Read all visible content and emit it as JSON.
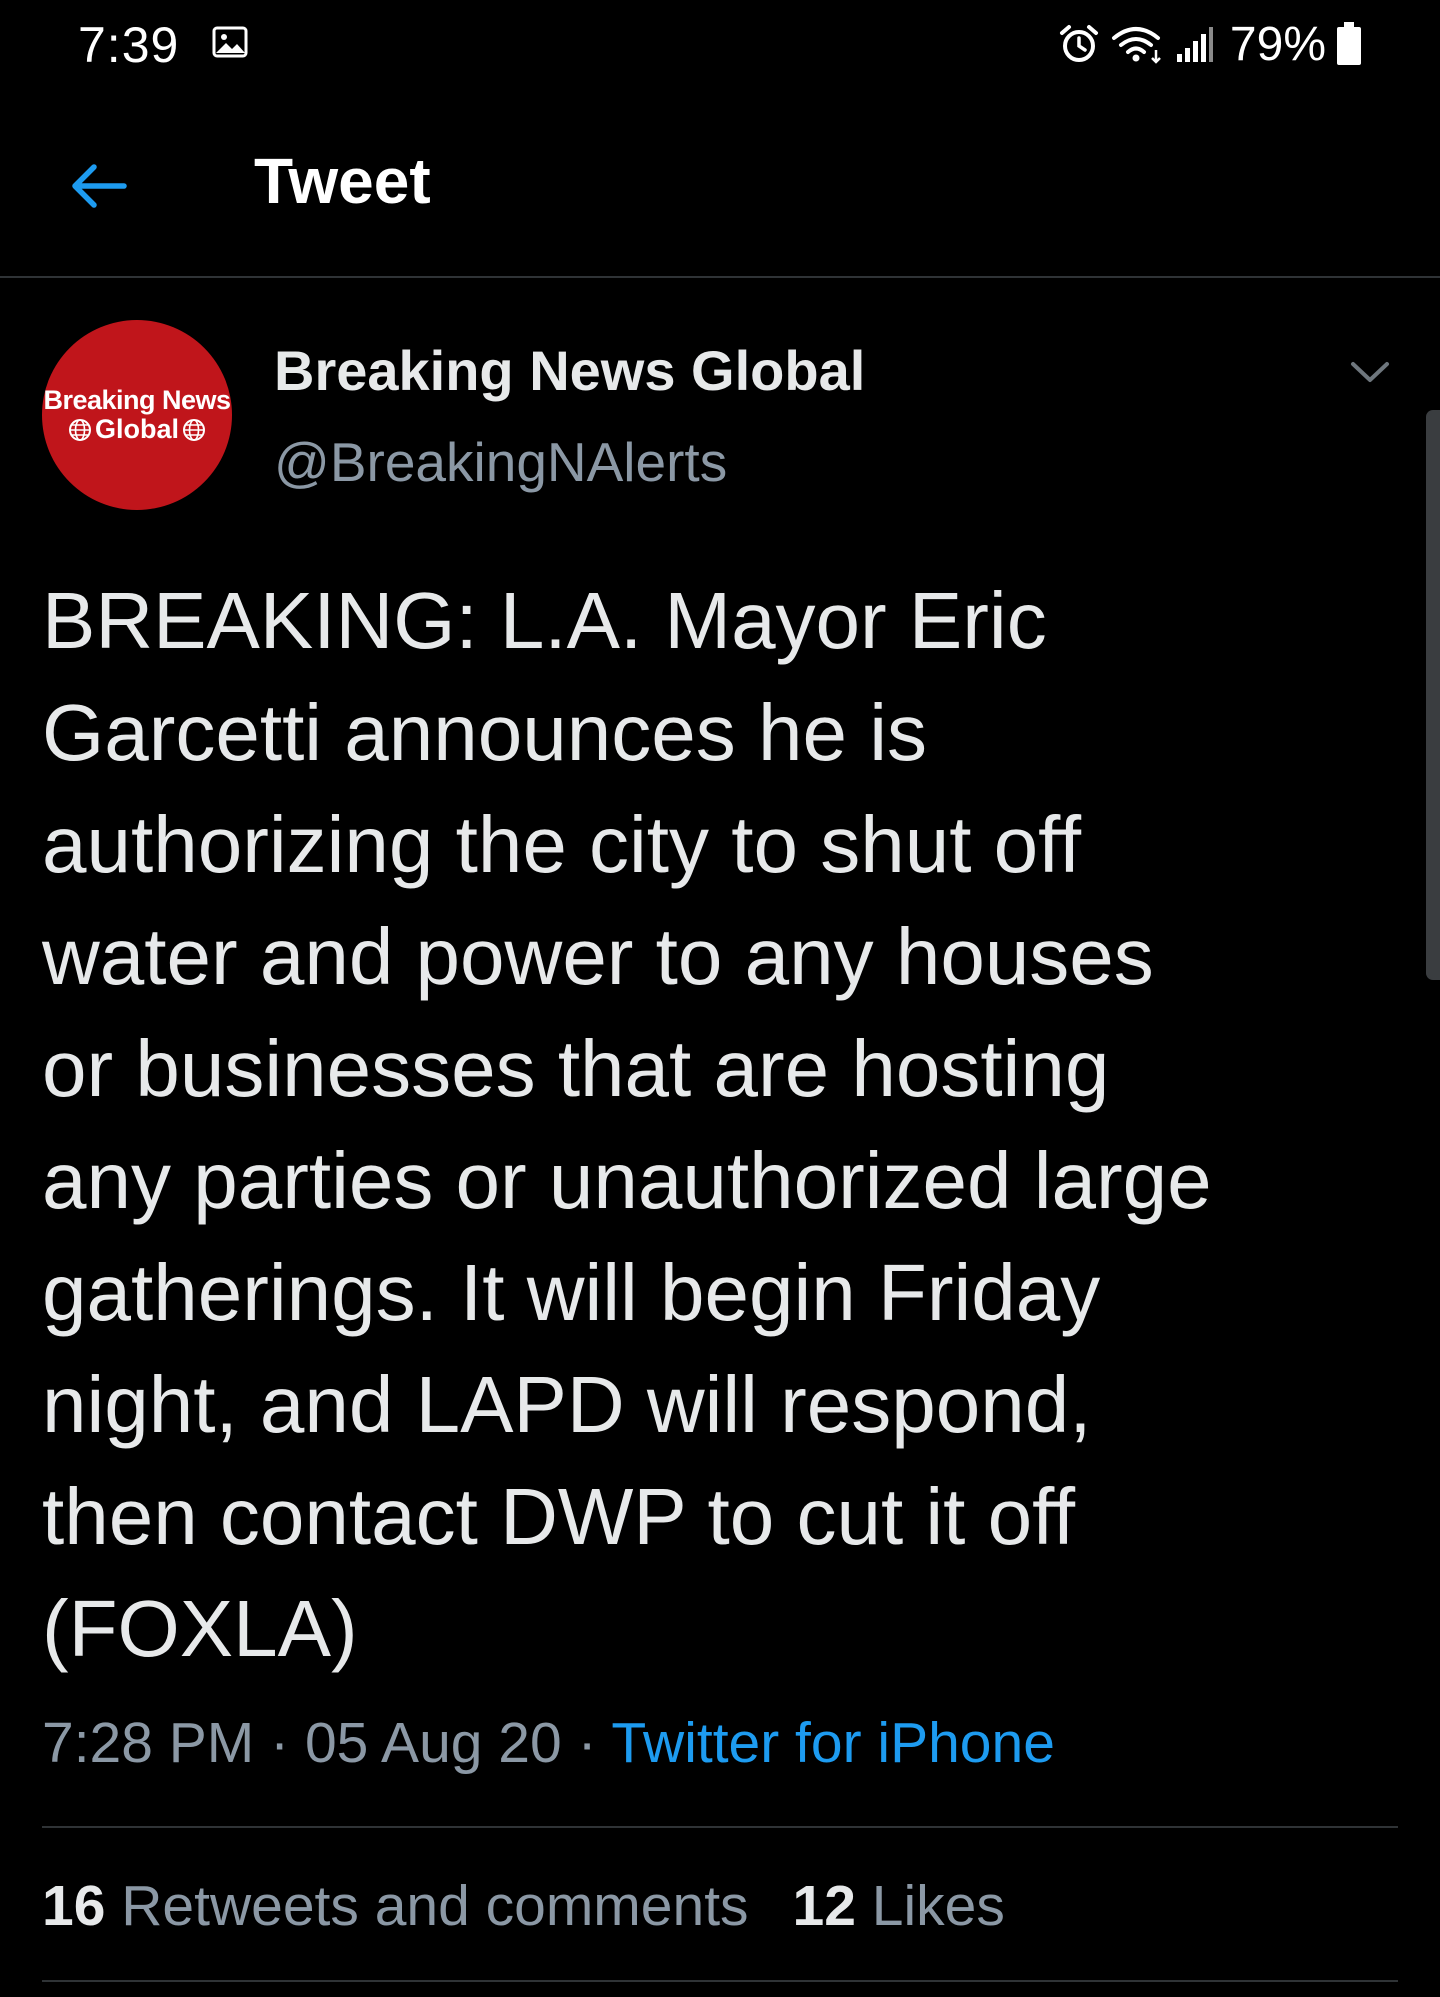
{
  "status_bar": {
    "time": "7:39",
    "battery": "79%",
    "icons": [
      "gallery-icon",
      "alarm-icon",
      "wifi-icon",
      "signal-icon",
      "battery-icon"
    ]
  },
  "header": {
    "back_icon": "arrow-left-icon",
    "title": "Tweet"
  },
  "tweet": {
    "author": {
      "avatar_text_line1": "Breaking News",
      "avatar_text_line2": "Global",
      "name": "Breaking News Global",
      "handle": "@BreakingNAlerts"
    },
    "menu_icon": "chevron-down-icon",
    "text_lines": [
      "BREAKING: L.A. Mayor Eric",
      "Garcetti announces he is",
      "authorizing the city to shut off",
      "water and power to any houses",
      "or businesses that are hosting",
      "any parties or unauthorized large",
      "gatherings. It will begin Friday",
      "night, and LAPD will respond,",
      "then contact DWP to cut it off",
      "(FOXLA)"
    ],
    "time": "7:28 PM",
    "date": "05 Aug 20",
    "separator": "·",
    "source": "Twitter for iPhone",
    "stats": {
      "retweets_count": "16",
      "retweets_label": "Retweets and comments",
      "likes_count": "12",
      "likes_label": "Likes"
    }
  },
  "colors": {
    "background": "#000000",
    "text": "#e7e9ea",
    "secondary_text": "#8b98a5",
    "accent": "#1d9bf0",
    "divider": "#2f3336",
    "avatar": "#c0151b"
  }
}
